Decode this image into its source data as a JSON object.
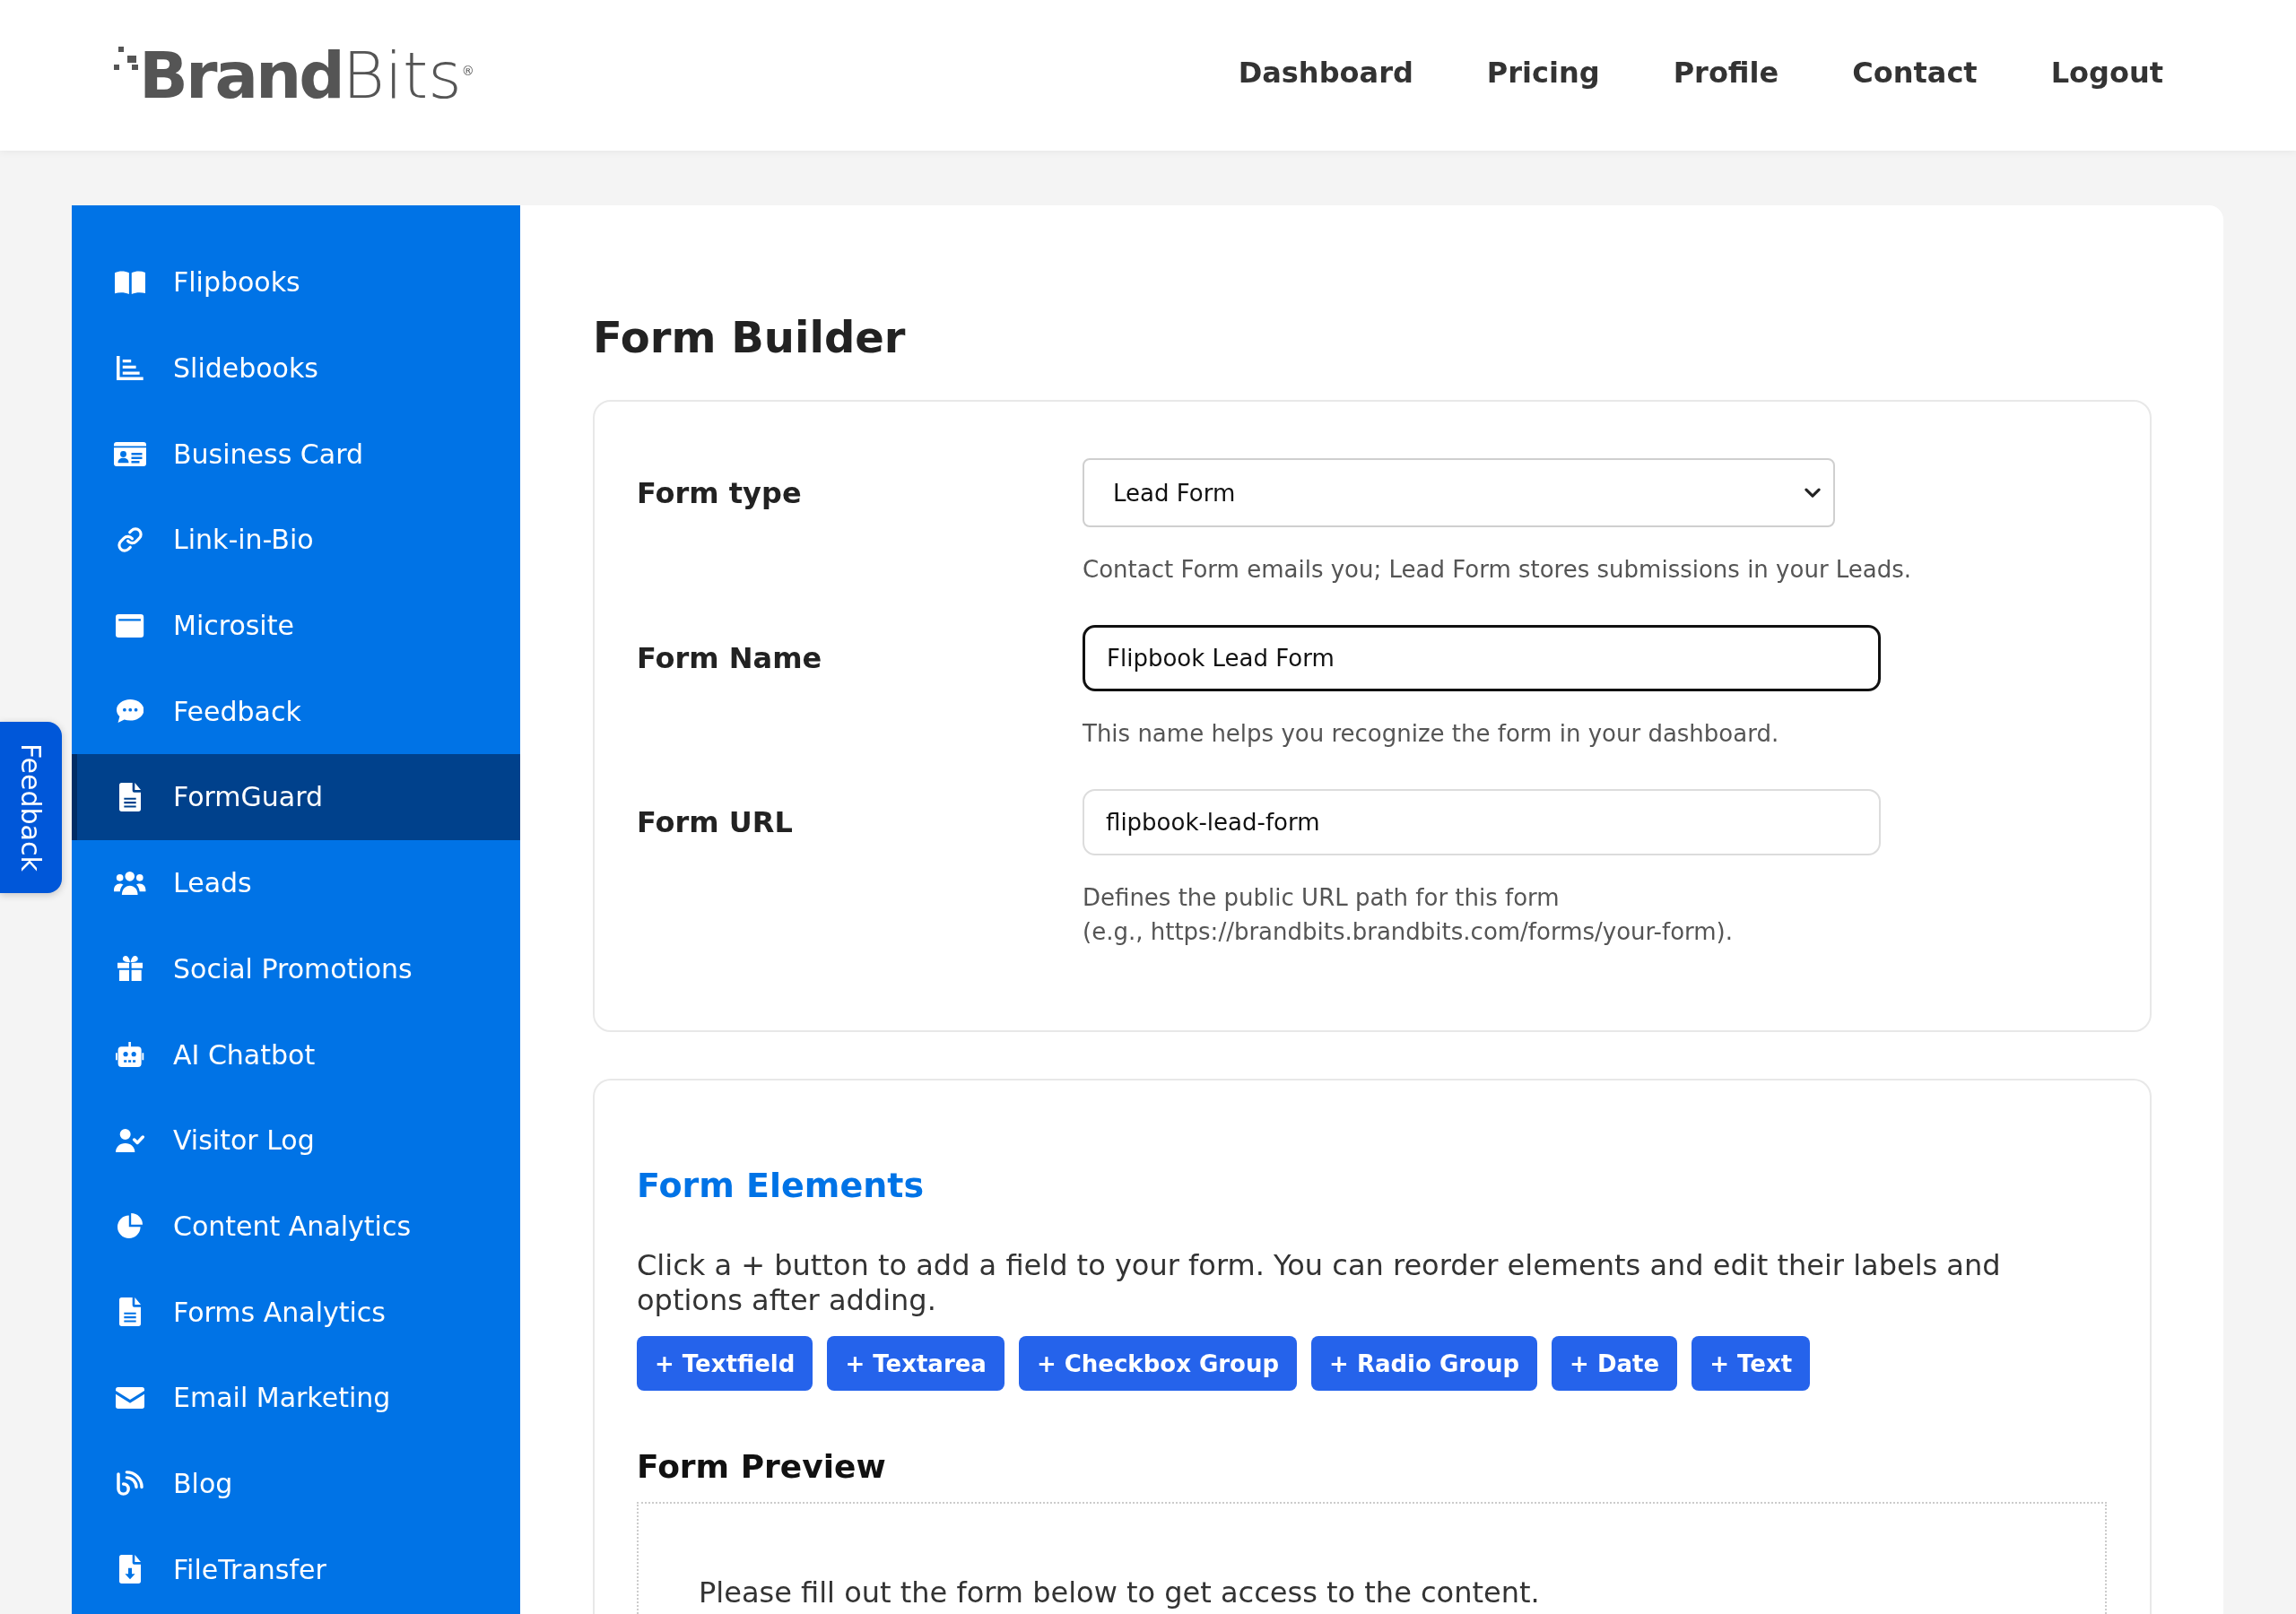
{
  "header": {
    "logo": "**Brand**Bits$^{®}$",
    "nav": [
      "Dashboard",
      "Pricing",
      "Profile",
      "Contact",
      "Logout"
    ]
  },
  "feedback_tab": {
    "label": "Feedback"
  },
  "sidebar": {
    "items": [
      {
        "label": "Flipbooks",
        "selected": false
      },
      {
        "label": "Slidebooks",
        "selected": false
      },
      {
        "label": "Business Card",
        "selected": false
      },
      {
        "label": "Link-in-Bio",
        "selected": false
      },
      {
        "label": "Microsite",
        "selected": false
      },
      {
        "label": "Feedback",
        "selected": false
      },
      {
        "label": "FormGuard",
        "selected": true
      },
      {
        "label": "Leads",
        "selected": false
      },
      {
        "label": "Social Promotions",
        "selected": false
      },
      {
        "label": "AI Chatbot",
        "selected": false
      },
      {
        "label": "Visitor Log",
        "selected": false
      },
      {
        "label": "Content Analytics",
        "selected": false
      },
      {
        "label": "Forms Analytics",
        "selected": false
      },
      {
        "label": "Email Marketing",
        "selected": false
      },
      {
        "label": "Blog",
        "selected": false
      },
      {
        "label": "FileTransfer",
        "selected": false
      }
    ]
  },
  "form_builder": {
    "title": "Form Builder",
    "settings": [
      {
        "kind": "select",
        "label": "Form type",
        "value": "Lead Form",
        "focused": false,
        "help": [
          "Contact Form emails you; Lead Form stores submissions in your Leads."
        ]
      },
      {
        "kind": "input",
        "label": "Form Name",
        "value": "Flipbook Lead Form",
        "focused": true,
        "help": [
          "This name helps you recognize the form in your dashboard."
        ]
      },
      {
        "kind": "input",
        "label": "Form URL",
        "value": "flipbook-lead-form",
        "focused": false,
        "help": [
          "Defines the public URL path for this form",
          "(e.g., https://brandbits.brandbits.com/forms/your-form)."
        ]
      }
    ],
    "form_elements": {
      "title": "Form Elements",
      "instructions": "Click a + button to add a field to your form. You can reorder elements and edit their labels and options after adding.",
      "add_buttons": [
        "+ Textfield",
        "+ Textarea",
        "+ Checkbox Group",
        "+ Radio Group",
        "+ Date",
        "+ Text"
      ]
    },
    "form_preview": {
      "title": "Form Preview",
      "message": "Please fill out the form below to get access to the content."
    }
  }
}
